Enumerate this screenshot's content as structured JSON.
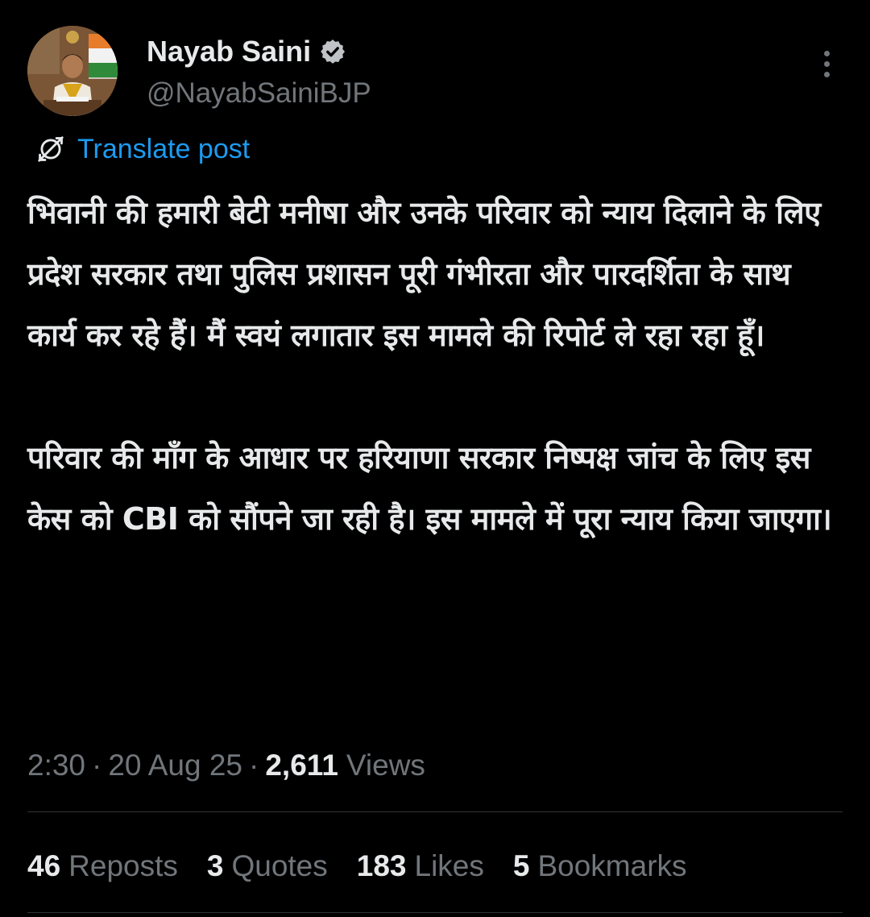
{
  "author": {
    "display_name": "Nayab Saini",
    "handle": "@NayabSainiBJP",
    "verified": true,
    "avatar": "profile-photo"
  },
  "translate": {
    "label": "Translate post",
    "icon": "translate-globe-icon"
  },
  "post": {
    "text": "भिवानी की हमारी बेटी मनीषा और उनके परिवार को न्याय दिलाने के लिए प्रदेश सरकार तथा पुलिस प्रशासन पूरी गंभीरता और पारदर्शिता के साथ कार्य कर रहे हैं। मैं स्वयं लगातार इस मामले की रिपोर्ट ले रहा रहा हूँ।\n\nपरिवार की माँग के आधार पर हरियाणा सरकार निष्पक्ष जांच के लिए इस केस को CBI को सौंपने जा रही है। इस मामले में पूरा न्याय किया जाएगा।"
  },
  "meta": {
    "time": "2:30",
    "separator": "·",
    "date": "20 Aug 25",
    "views_count": "2,611",
    "views_label": "Views"
  },
  "stats": {
    "reposts": {
      "count": "46",
      "label": "Reposts"
    },
    "quotes": {
      "count": "3",
      "label": "Quotes"
    },
    "likes": {
      "count": "183",
      "label": "Likes"
    },
    "bookmarks": {
      "count": "5",
      "label": "Bookmarks"
    }
  },
  "colors": {
    "background": "#000000",
    "text": "#e7e9ea",
    "muted": "#71767b",
    "link": "#1d9bf0",
    "divider": "#2f3336"
  }
}
